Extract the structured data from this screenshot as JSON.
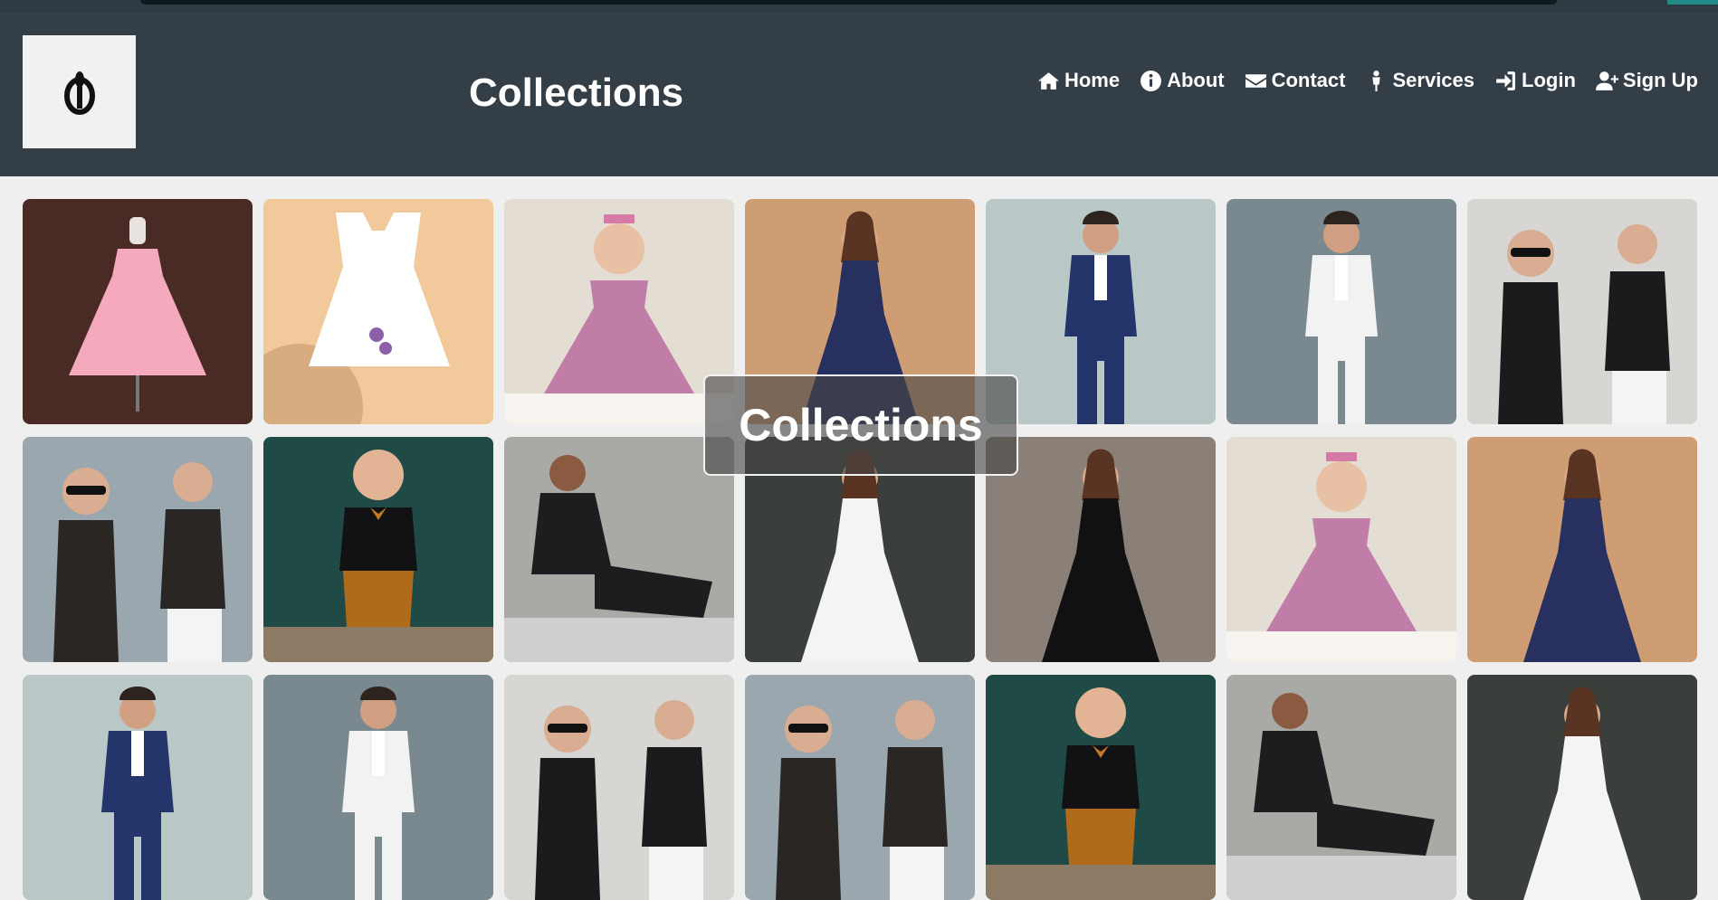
{
  "header": {
    "title": "Collections",
    "nav": [
      {
        "label": "Home",
        "icon": "home-icon"
      },
      {
        "label": "About",
        "icon": "info-icon"
      },
      {
        "label": "Contact",
        "icon": "envelope-icon"
      },
      {
        "label": "Services",
        "icon": "person-icon"
      },
      {
        "label": "Login",
        "icon": "sign-in-icon"
      },
      {
        "label": "Sign Up",
        "icon": "user-plus-icon"
      }
    ]
  },
  "overlay": {
    "label": "Collections"
  },
  "colors": {
    "header_bg": "#343e46",
    "page_bg": "#efefef"
  },
  "gallery": [
    {
      "kind": "pink tutu dress on mannequin",
      "bg": "#4a2a24",
      "fg": "#f4a9bd",
      "shape": "dress"
    },
    {
      "kind": "white embroidered baby frock",
      "bg": "#f2c99b",
      "fg": "#ffffff",
      "shape": "frock"
    },
    {
      "kind": "baby girl in pink tulle dress",
      "bg": "#e4ddd3",
      "fg": "#c07da8",
      "shape": "baby"
    },
    {
      "kind": "woman in navy anarkali",
      "bg": "#cf9d73",
      "fg": "#27305e",
      "shape": "gown"
    },
    {
      "kind": "man in navy suit",
      "bg": "#b9c8c6",
      "fg": "#24356b",
      "shape": "man"
    },
    {
      "kind": "man in light blue blazer",
      "bg": "#7a8890",
      "fg": "#f2f2f2",
      "shape": "man"
    },
    {
      "kind": "boys in black shirts",
      "bg": "#d8d6d2",
      "fg": "#1b1b1e",
      "shape": "boys"
    },
    {
      "kind": "boy in leather jacket with sunglasses",
      "bg": "#9aa7ae",
      "fg": "#2a2624",
      "shape": "boys"
    },
    {
      "kind": "boy in bow tie and shorts",
      "bg": "#1f4a46",
      "fg": "#b06a1c",
      "shape": "kid"
    },
    {
      "kind": "man in black suit posing",
      "bg": "#a9a9a6",
      "fg": "#1d1d1f",
      "shape": "sit"
    },
    {
      "kind": "woman in white gown",
      "bg": "#3a3f3b",
      "fg": "#f4f4f4",
      "shape": "gown"
    },
    {
      "kind": "woman in black dress",
      "bg": "#8a8078",
      "fg": "#111114",
      "shape": "gown"
    },
    {
      "kind": "baby girl in pink tulle dress",
      "bg": "#e4ddd3",
      "fg": "#c07da8",
      "shape": "baby"
    },
    {
      "kind": "woman in navy anarkali",
      "bg": "#cf9d73",
      "fg": "#27305e",
      "shape": "gown"
    },
    {
      "kind": "man in navy suit",
      "bg": "#b9c8c6",
      "fg": "#24356b",
      "shape": "man"
    },
    {
      "kind": "man in light blue blazer",
      "bg": "#7a8890",
      "fg": "#f2f2f2",
      "shape": "man"
    },
    {
      "kind": "boys in black shirts",
      "bg": "#d8d6d2",
      "fg": "#1b1b1e",
      "shape": "boys"
    },
    {
      "kind": "boy in leather jacket with sunglasses",
      "bg": "#9aa7ae",
      "fg": "#2a2624",
      "shape": "boys"
    },
    {
      "kind": "boy in bow tie and shorts",
      "bg": "#1f4a46",
      "fg": "#b06a1c",
      "shape": "kid"
    },
    {
      "kind": "man in black suit posing",
      "bg": "#a9a9a6",
      "fg": "#1d1d1f",
      "shape": "sit"
    },
    {
      "kind": "woman in white gown",
      "bg": "#3a3f3b",
      "fg": "#f4f4f4",
      "shape": "gown"
    }
  ]
}
